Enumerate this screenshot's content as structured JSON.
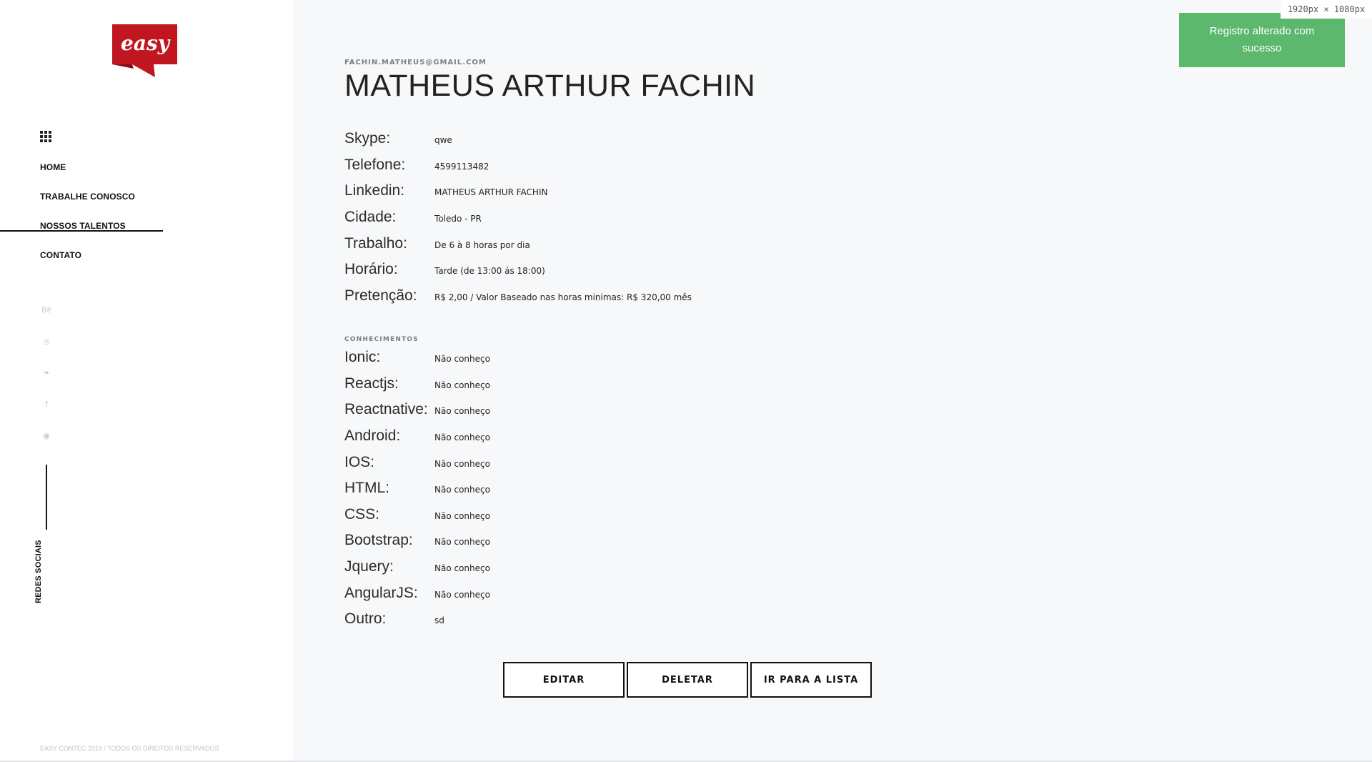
{
  "brand": {
    "logo_text": "easy",
    "logo_color": "#c0161f"
  },
  "nav": {
    "items": [
      {
        "label": "HOME"
      },
      {
        "label": "TRABALHE CONOSCO"
      },
      {
        "label": "NOSSOS TALENTOS"
      },
      {
        "label": "CONTATO"
      }
    ],
    "active_index": 1
  },
  "social": {
    "icons": [
      "behance-icon",
      "dribbble-icon",
      "twitter-icon",
      "facebook-icon",
      "github-icon"
    ],
    "label": "REDES SOCIAIS"
  },
  "footer": {
    "copyright": "EASY CONTEC 2019 / TODOS OS DIREITOS RESERVADOS"
  },
  "profile": {
    "email": "FACHIN.MATHEUS@GMAIL.COM",
    "name": "MATHEUS ARTHUR FACHIN",
    "fields": [
      {
        "label": "Skype:",
        "value": "qwe"
      },
      {
        "label": "Telefone:",
        "value": "4599113482"
      },
      {
        "label": "Linkedin:",
        "value": "MATHEUS ARTHUR FACHIN"
      },
      {
        "label": "Cidade:",
        "value": "Toledo - PR"
      },
      {
        "label": "Trabalho:",
        "value": "De 6 à 8 horas por dia"
      },
      {
        "label": "Horário:",
        "value": "Tarde (de 13:00 ás 18:00)"
      },
      {
        "label": "Pretenção:",
        "value": "R$ 2,00 / Valor Baseado nas horas minimas: R$ 320,00 mês"
      }
    ]
  },
  "knowledge": {
    "title": "CONHECIMENTOS",
    "items": [
      {
        "label": "Ionic:",
        "value": "Não conheço"
      },
      {
        "label": "Reactjs:",
        "value": "Não conheço"
      },
      {
        "label": "Reactnative:",
        "value": "Não conheço"
      },
      {
        "label": "Android:",
        "value": "Não conheço"
      },
      {
        "label": "IOS:",
        "value": "Não conheço"
      },
      {
        "label": "HTML:",
        "value": "Não conheço"
      },
      {
        "label": "CSS:",
        "value": "Não conheço"
      },
      {
        "label": "Bootstrap:",
        "value": "Não conheço"
      },
      {
        "label": "Jquery:",
        "value": "Não conheço"
      },
      {
        "label": "AngularJS:",
        "value": "Não conheço"
      },
      {
        "label": "Outro:",
        "value": "sd"
      }
    ]
  },
  "actions": {
    "edit": "EDITAR",
    "delete": "DELETAR",
    "list": "IR PARA A LISTA"
  },
  "toast": {
    "message": "Registro alterado com sucesso",
    "color": "#5cb86d"
  },
  "dimensions_badge": "1920px × 1080px"
}
